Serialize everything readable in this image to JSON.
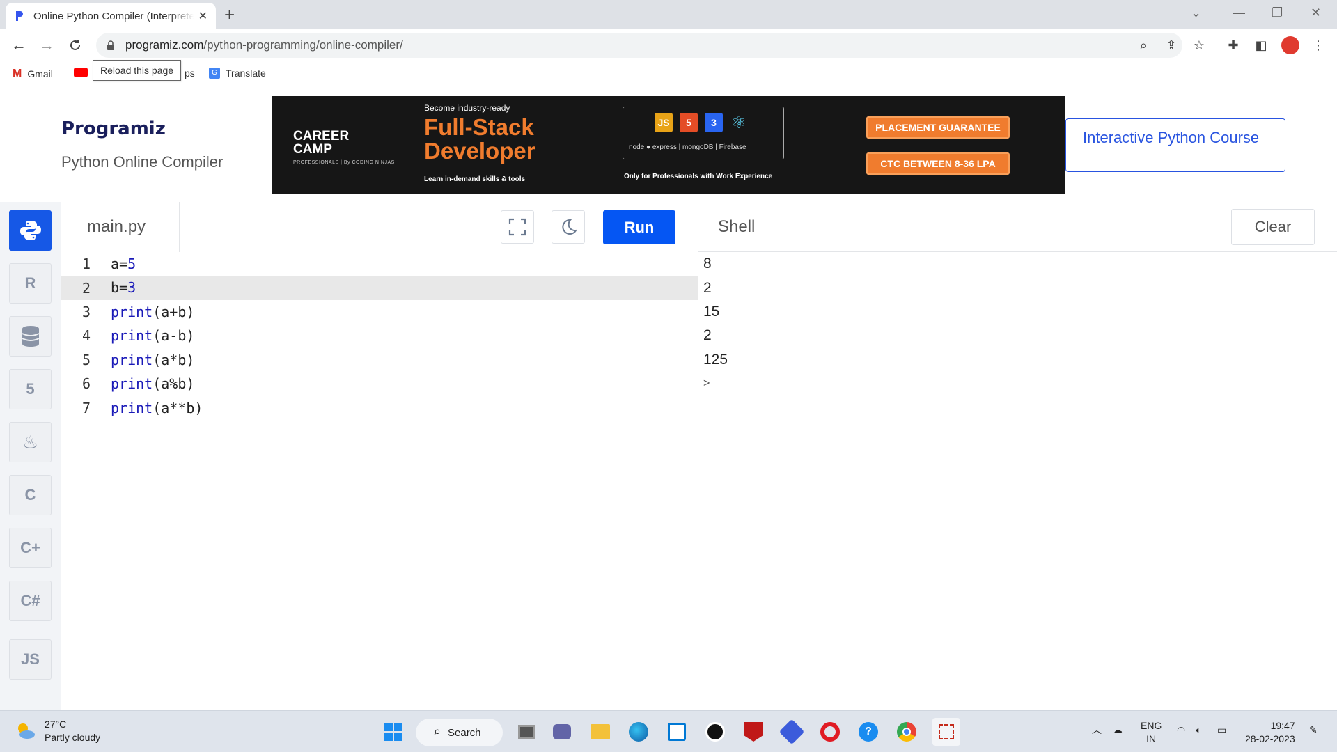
{
  "browser": {
    "tab_title": "Online Python Compiler (Interpreter)",
    "url_host": "programiz.com",
    "url_path": "/python-programming/online-compiler/",
    "tooltip": "Reload this page",
    "bookmarks": [
      {
        "label": "Gmail",
        "icon": "gmail-icon"
      },
      {
        "label": "ps",
        "icon": "youtube-icon"
      },
      {
        "label": "Translate",
        "icon": "translate-icon"
      }
    ]
  },
  "site": {
    "logo": "Programiz",
    "subtitle": "Python Online Compiler",
    "course_button": "Interactive Python Course"
  },
  "ad": {
    "brand_top": "CAREER",
    "brand_bottom": "CAMP",
    "brand_small": "PROFESSIONALS | By CODING NINJAS",
    "become": "Become industry-ready",
    "headline_1": "Full-Stack",
    "headline_2": "Developer",
    "learn": "Learn in-demand skills & tools",
    "tech_row": "node ● express | mongoDB | Firebase",
    "only": "Only for Professionals with Work Experience",
    "pill_1": "PLACEMENT GUARANTEE",
    "pill_2": "CTC BETWEEN 8-36 LPA"
  },
  "editor": {
    "file_name": "main.py",
    "run_label": "Run",
    "current_line": 2,
    "lines": [
      {
        "n": "1",
        "code": "a=5"
      },
      {
        "n": "2",
        "code": "b=3"
      },
      {
        "n": "3",
        "code": "print(a+b)"
      },
      {
        "n": "4",
        "code": "print(a-b)"
      },
      {
        "n": "5",
        "code": "print(a*b)"
      },
      {
        "n": "6",
        "code": "print(a%b)"
      },
      {
        "n": "7",
        "code": "print(a**b)"
      }
    ]
  },
  "shell": {
    "title": "Shell",
    "clear_label": "Clear",
    "output": [
      "8",
      "2",
      "15",
      "2",
      "125"
    ],
    "prompt": ">"
  },
  "rail": {
    "languages": [
      "python-icon",
      "r-icon",
      "sql-icon",
      "html5-icon",
      "java-icon",
      "c-icon",
      "cpp-icon",
      "csharp-icon",
      "js-icon"
    ],
    "js_label": "JS"
  },
  "taskbar": {
    "temperature": "27°C",
    "weather": "Partly cloudy",
    "search": "Search",
    "lang_1": "ENG",
    "lang_2": "IN",
    "time": "19:47",
    "date": "28-02-2023"
  },
  "colors": {
    "accent": "#0556f3",
    "ad_orange": "#f07c2e"
  }
}
